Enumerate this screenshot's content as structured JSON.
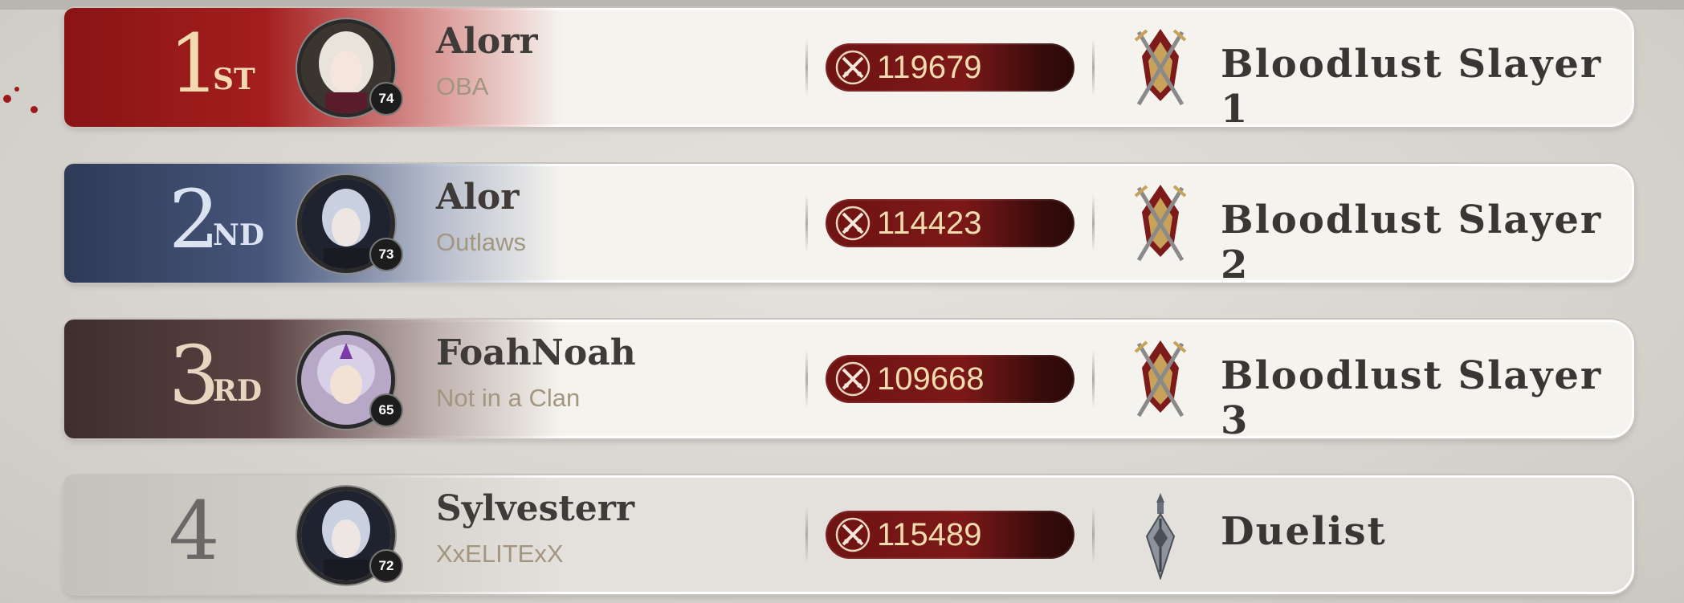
{
  "leaderboard": {
    "rows": [
      {
        "rank": "1",
        "suffix": "ST",
        "level": "74",
        "name": "Alorr",
        "clan": "OBA",
        "score": "119679",
        "title": "Bloodlust Slayer 1",
        "title_icon": "crossed-swords-crest-icon"
      },
      {
        "rank": "2",
        "suffix": "ND",
        "level": "73",
        "name": "Alor",
        "clan": "Outlaws",
        "score": "114423",
        "title": "Bloodlust Slayer 2",
        "title_icon": "crossed-swords-crest-icon"
      },
      {
        "rank": "3",
        "suffix": "RD",
        "level": "65",
        "name": "FoahNoah",
        "clan": "Not in a Clan",
        "score": "109668",
        "title": "Bloodlust Slayer 3",
        "title_icon": "crossed-swords-crest-icon"
      },
      {
        "rank": "4",
        "suffix": "",
        "level": "72",
        "name": "Sylvesterr",
        "clan": "XxELITExX",
        "score": "115489",
        "title": "Duelist",
        "title_icon": "sword-emblem-icon"
      }
    ]
  },
  "colors": {
    "rank1": "#a31e1e",
    "rank2": "#46557a",
    "rank3": "#5a4242",
    "score_pill": "#7d1818",
    "score_text": "#f1dcaf",
    "clan_text": "#a39681"
  }
}
